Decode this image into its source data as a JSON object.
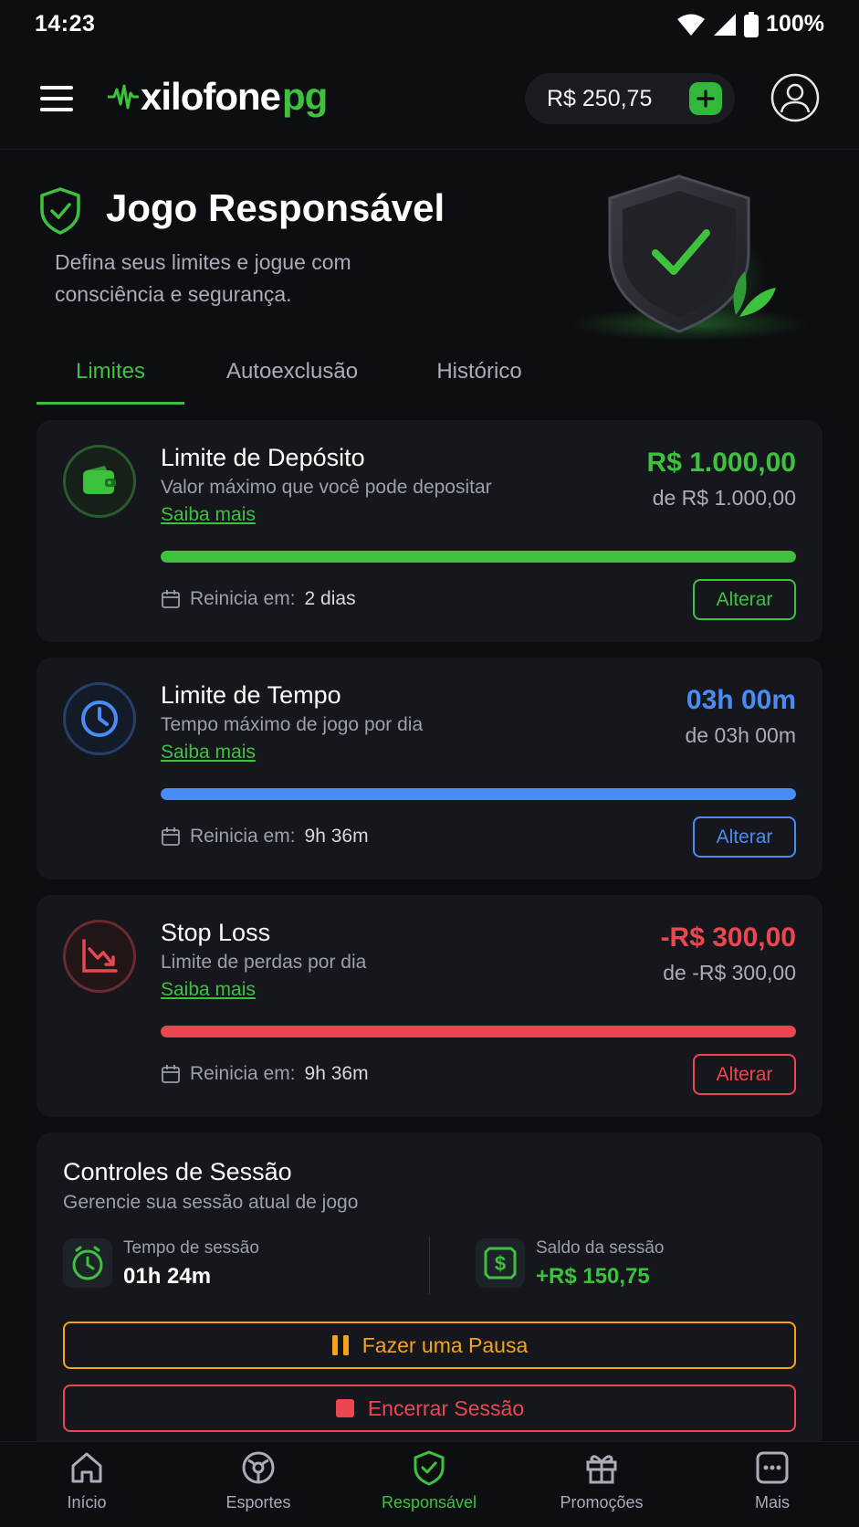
{
  "status": {
    "time": "14:23",
    "battery": "100%"
  },
  "header": {
    "logo_main": "xilofone",
    "logo_accent": "pg",
    "balance": "R$ 250,75"
  },
  "hero": {
    "title": "Jogo Responsável",
    "subtitle": "Defina seus limites e jogue com consciência e segurança."
  },
  "tabs": [
    {
      "label": "Limites",
      "active": true
    },
    {
      "label": "Autoexclusão",
      "active": false
    },
    {
      "label": "Histórico",
      "active": false
    }
  ],
  "limits": [
    {
      "title": "Limite de Depósito",
      "description": "Valor máximo que você pode depositar",
      "link": "Saiba mais",
      "amount": "R$ 1.000,00",
      "of": "de R$ 1.000,00",
      "progress": 1.0,
      "reset_label": "Reinicia em:",
      "reset_value": "2 dias",
      "button": "Alterar",
      "color": "#3ec23e",
      "icon": "wallet-icon"
    },
    {
      "title": "Limite de Tempo",
      "description": "Tempo máximo de jogo por dia",
      "link": "Saiba mais",
      "amount": "03h 00m",
      "of": "de 03h 00m",
      "progress": 1.0,
      "reset_label": "Reinicia em:",
      "reset_value": "9h 36m",
      "button": "Alterar",
      "color": "#4a8cf5",
      "icon": "clock-icon"
    },
    {
      "title": "Stop Loss",
      "description": "Limite de perdas por dia",
      "link": "Saiba mais",
      "amount": "-R$ 300,00",
      "of": "de -R$ 300,00",
      "progress": 1.0,
      "reset_label": "Reinicia em:",
      "reset_value": "9h 36m",
      "button": "Alterar",
      "color": "#ec4750",
      "icon": "chart-down-icon"
    }
  ],
  "session": {
    "title": "Controles de Sessão",
    "subtitle": "Gerencie sua sessão atual de jogo",
    "time_label": "Tempo de sessão",
    "time_value": "01h 24m",
    "balance_label": "Saldo da sessão",
    "balance_value": "+R$ 150,75",
    "pause_button": "Fazer uma Pausa",
    "end_button": "Encerrar Sessão",
    "pause_color": "#f5a31a",
    "end_color": "#ec4750"
  },
  "nav": [
    {
      "label": "Início",
      "icon": "home-icon",
      "active": false
    },
    {
      "label": "Esportes",
      "icon": "sports-icon",
      "active": false
    },
    {
      "label": "Responsável",
      "icon": "shield-check-icon",
      "active": true
    },
    {
      "label": "Promoções",
      "icon": "gift-icon",
      "active": false
    },
    {
      "label": "Mais",
      "icon": "more-icon",
      "active": false
    }
  ]
}
